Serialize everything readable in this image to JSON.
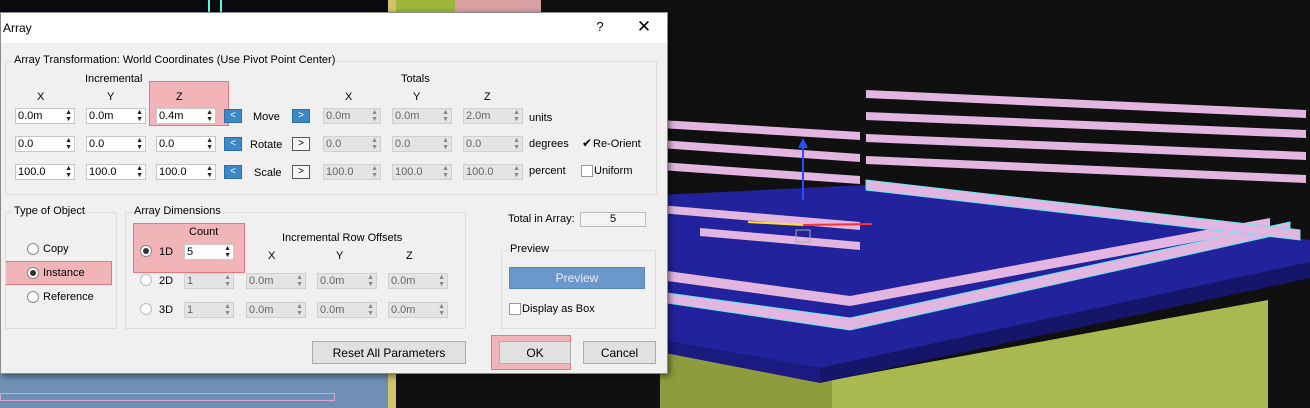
{
  "dialog": {
    "title": "Array",
    "help_label": "?",
    "close_label": "✕"
  },
  "transformation": {
    "group_label": "Array Transformation: World Coordinates (Use Pivot Point Center)",
    "incremental_label": "Incremental",
    "totals_label": "Totals",
    "axes": [
      "X",
      "Y",
      "Z"
    ],
    "rows": [
      {
        "label": "Move",
        "incremental": [
          "0.0m",
          "0.0m",
          "0.4m"
        ],
        "totals": [
          "0.0m",
          "0.0m",
          "2.0m"
        ],
        "unit": "units",
        "left_arrow": "<",
        "right_arrow": ">"
      },
      {
        "label": "Rotate",
        "incremental": [
          "0.0",
          "0.0",
          "0.0"
        ],
        "totals": [
          "0.0",
          "0.0",
          "0.0"
        ],
        "unit": "degrees",
        "left_arrow": "<",
        "right_arrow": ">",
        "option_label": "Re-Orient",
        "option_checked": true
      },
      {
        "label": "Scale",
        "incremental": [
          "100.0",
          "100.0",
          "100.0"
        ],
        "totals": [
          "100.0",
          "100.0",
          "100.0"
        ],
        "unit": "percent",
        "left_arrow": "<",
        "right_arrow": ">",
        "option_label": "Uniform",
        "option_checked": false
      }
    ]
  },
  "type_of_object": {
    "group_label": "Type of Object",
    "options": [
      "Copy",
      "Instance",
      "Reference"
    ],
    "selected": "Instance"
  },
  "array_dimensions": {
    "group_label": "Array Dimensions",
    "count_label": "Count",
    "row_offsets_label": "Incremental Row Offsets",
    "axes": [
      "X",
      "Y",
      "Z"
    ],
    "rows": [
      {
        "label": "1D",
        "count": "5",
        "offsets": []
      },
      {
        "label": "2D",
        "count": "1",
        "offsets": [
          "0.0m",
          "0.0m",
          "0.0m"
        ]
      },
      {
        "label": "3D",
        "count": "1",
        "offsets": [
          "0.0m",
          "0.0m",
          "0.0m"
        ]
      }
    ],
    "selected": "1D"
  },
  "total_in_array": {
    "label": "Total in Array:",
    "value": "5"
  },
  "preview": {
    "group_label": "Preview",
    "button_label": "Preview",
    "display_as_box_label": "Display as Box"
  },
  "buttons": {
    "reset": "Reset All Parameters",
    "ok": "OK",
    "cancel": "Cancel"
  },
  "colors": {
    "dialog_bg": "#f0f0f0",
    "highlight": "#f0a0a6",
    "active_arrow": "#3c88c8",
    "preview_button": "#6a98cc",
    "scene_pink": "#e2b6e0",
    "scene_blue": "#22229c",
    "scene_green": "#a9b84f"
  }
}
